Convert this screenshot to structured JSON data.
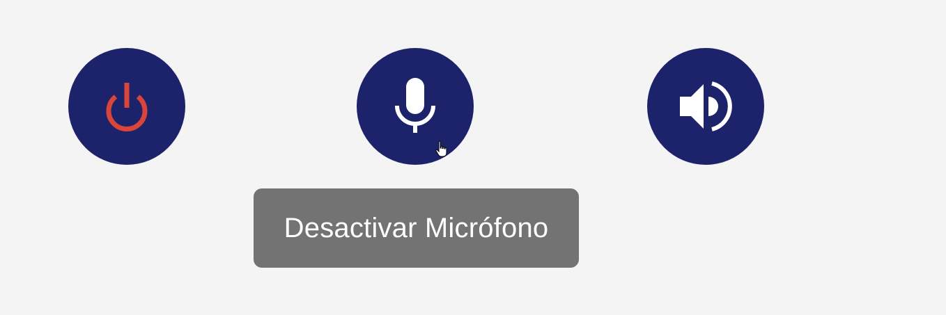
{
  "controls": [
    {
      "id": "power",
      "icon": "power-icon",
      "icon_color": "#d9453a"
    },
    {
      "id": "microphone",
      "icon": "microphone-icon",
      "icon_color": "#ffffff"
    },
    {
      "id": "speaker",
      "icon": "speaker-volume-icon",
      "icon_color": "#ffffff"
    }
  ],
  "tooltip": {
    "text": "Desactivar Micrófono"
  },
  "colors": {
    "background": "#f4f4f4",
    "button": "#1d236b",
    "tooltip_bg": "#737373",
    "power": "#d9453a"
  }
}
